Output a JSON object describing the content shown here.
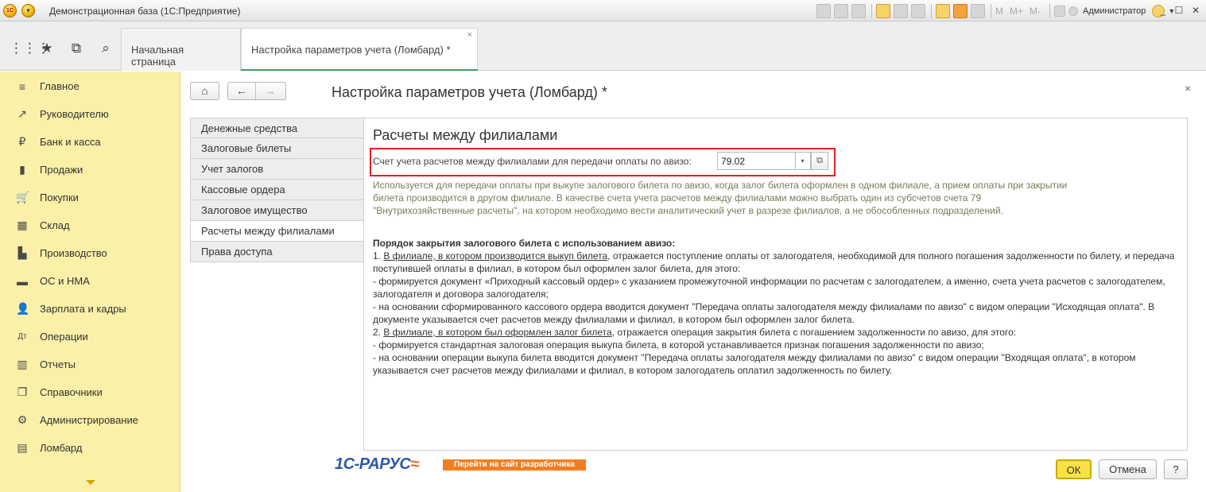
{
  "window": {
    "title": "Демонстрационная база  (1С:Предприятие)",
    "logo_text": "1С",
    "user": "Администратор",
    "tools_m": [
      "M",
      "M+",
      "M-"
    ],
    "controls": {
      "minimize": "_",
      "maximize": "☐",
      "close": "✕"
    }
  },
  "tabs": [
    {
      "label": "Начальная страница"
    },
    {
      "label": "Настройка параметров учета (Ломбард) *"
    }
  ],
  "sidebar": {
    "items": [
      {
        "label": "Главное",
        "icon": "≡"
      },
      {
        "label": "Руководителю",
        "icon": "↗"
      },
      {
        "label": "Банк и касса",
        "icon": "₽"
      },
      {
        "label": "Продажи",
        "icon": "▮"
      },
      {
        "label": "Покупки",
        "icon": "🛒"
      },
      {
        "label": "Склад",
        "icon": "▦"
      },
      {
        "label": "Производство",
        "icon": "▙"
      },
      {
        "label": "ОС и НМА",
        "icon": "▬"
      },
      {
        "label": "Зарплата и кадры",
        "icon": "👤"
      },
      {
        "label": "Операции",
        "icon": "Дт"
      },
      {
        "label": "Отчеты",
        "icon": "▥"
      },
      {
        "label": "Справочники",
        "icon": "❐"
      },
      {
        "label": "Администрирование",
        "icon": "⚙"
      },
      {
        "label": "Ломбард",
        "icon": "▤"
      }
    ]
  },
  "form": {
    "title": "Настройка параметров учета (Ломбард) *",
    "close": "×",
    "nav": {
      "home": "⌂",
      "back": "←",
      "forward": "→"
    },
    "sections": [
      "Денежные средства",
      "Залоговые билеты",
      "Учет залогов",
      "Кассовые ордера",
      "Залоговое имущество",
      "Расчеты между филиалами",
      "Права доступа"
    ],
    "active_section_index": 5,
    "panel_title": "Расчеты между филиалами",
    "field": {
      "label": "Счет учета расчетов между филиалами для передачи оплаты по авизо:",
      "value": "79.02"
    },
    "hint_lines": [
      "Используется для передачи оплаты при выкупе залогового билета по авизо, когда залог билета оформлен в одном филиале, а прием оплаты при закрытии",
      "билета производится в другом филиале. В качестве счета учета расчетов между филиалами можно выбрать один из субсчетов счета 79",
      "\"Внутрихозяйственные расчеты\", на котором необходимо вести аналитический учет в разрезе филиалов, а не обособленных подразделений."
    ],
    "procedure": {
      "title": "Порядок закрытия залогового билета с использованием авизо:",
      "p1_num": "1. ",
      "p1_link": "В филиале, в котором производится выкуп билета",
      "p1_rest": ", отражается поступление оплаты от залогодателя, необходимой для полного погашения задолженности по билету, и передача поступившей оплаты в филиал, в котором был оформлен залог билета, для этого:",
      "p1_b1": " -  формируется документ «Приходный кассовый ордер» с указанием промежуточной информации по расчетам с залогодателем, а именно, счета учета расчетов с залогодателем, залогодателя и договора залогодателя;",
      "p1_b2": " -  на основании сформированного кассового ордера вводится документ \"Передача оплаты залогодателя между филиалами по авизо\" с видом операции \"Исходящая оплата\". В документе указывается счет расчетов между филиалами и филиал, в котором был оформлен залог билета.",
      "p2_num": "2. ",
      "p2_link": "В филиале, в котором был оформлен залог билета",
      "p2_rest": ", отражается операция закрытия билета с погашением задолженности по авизо, для этого:",
      "p2_b1": " -  формируется стандартная залоговая операция выкупа билета, в которой устанавливается признак погашения задолженности по авизо;",
      "p2_b2": " -  на основании операции выкупа билета вводится документ \"Передача оплаты залогодателя между филиалами по авизо\" с видом операции \"Входящая оплата\", в котором указывается счет расчетов между филиалами и филиал, в котором залогодатель оплатил задолженность по билету."
    },
    "vendor": {
      "logo_main": "1С-РАРУС",
      "logo_mark": "≈",
      "link_label": "Перейти на сайт разработчика"
    },
    "buttons": {
      "ok": "ОК",
      "cancel": "Отмена",
      "help": "?"
    }
  }
}
